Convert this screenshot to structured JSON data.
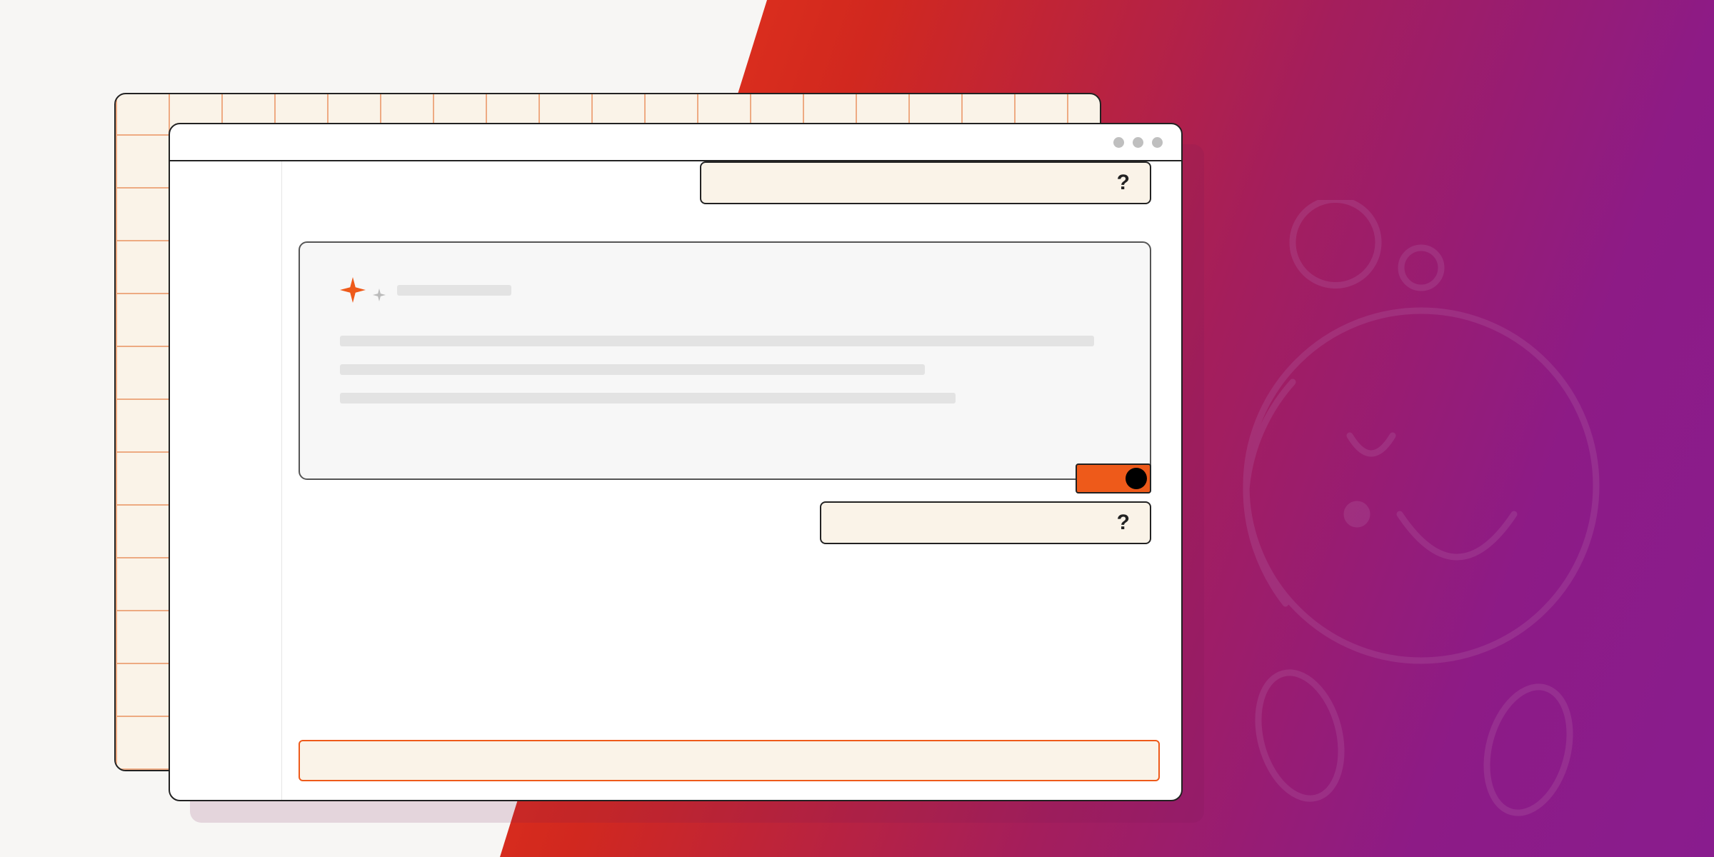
{
  "question1": "?",
  "question2": "?",
  "colors": {
    "accent": "#ee5a1a",
    "gradient_start": "#ee3a1a",
    "gradient_end": "#891c8e"
  },
  "icons": {
    "sparkle": "ai-sparkle"
  }
}
